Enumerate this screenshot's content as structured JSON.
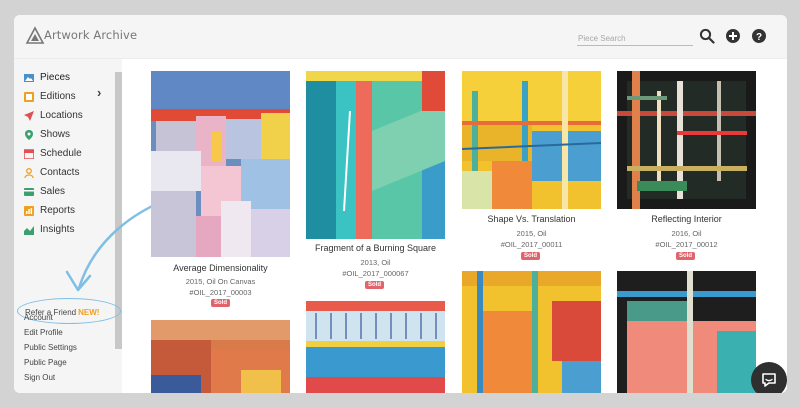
{
  "app": {
    "name": "Artwork Archive"
  },
  "search": {
    "placeholder": "Piece Search"
  },
  "sidebar": {
    "items": [
      {
        "label": "Pieces",
        "icon": "image-icon",
        "color": "#4a90c8"
      },
      {
        "label": "Editions",
        "icon": "editions-icon",
        "color": "#f0a020"
      },
      {
        "label": "Locations",
        "icon": "location-arrow-icon",
        "color": "#e05050"
      },
      {
        "label": "Shows",
        "icon": "map-pin-icon",
        "color": "#3aa070"
      },
      {
        "label": "Schedule",
        "icon": "calendar-icon",
        "color": "#e05050"
      },
      {
        "label": "Contacts",
        "icon": "contacts-icon",
        "color": "#f0a020"
      },
      {
        "label": "Sales",
        "icon": "credit-card-icon",
        "color": "#3aa070"
      },
      {
        "label": "Reports",
        "icon": "reports-icon",
        "color": "#f0a020"
      },
      {
        "label": "Insights",
        "icon": "insights-icon",
        "color": "#3aa070"
      }
    ],
    "refer_label": "Refer a Friend",
    "refer_badge": "NEW!",
    "links": [
      "Account",
      "Edit Profile",
      "Public Settings",
      "Public Page",
      "Sign Out"
    ]
  },
  "artworks": [
    {
      "title": "Average Dimensionality",
      "meta": "2015, Oil On Canvas",
      "id": "#OIL_2017_00003",
      "badge": "Sold"
    },
    {
      "title": "Fragment of a Burning Square",
      "meta": "2013, Oil",
      "id": "#OIL_2017_000067",
      "badge": "Sold"
    },
    {
      "title": "Shape Vs. Translation",
      "meta": "2015, Oil",
      "id": "#OIL_2017_00011",
      "badge": "Sold"
    },
    {
      "title": "Reflecting Interior",
      "meta": "2016, Oil",
      "id": "#OIL_2017_00012",
      "badge": "Sold"
    }
  ]
}
